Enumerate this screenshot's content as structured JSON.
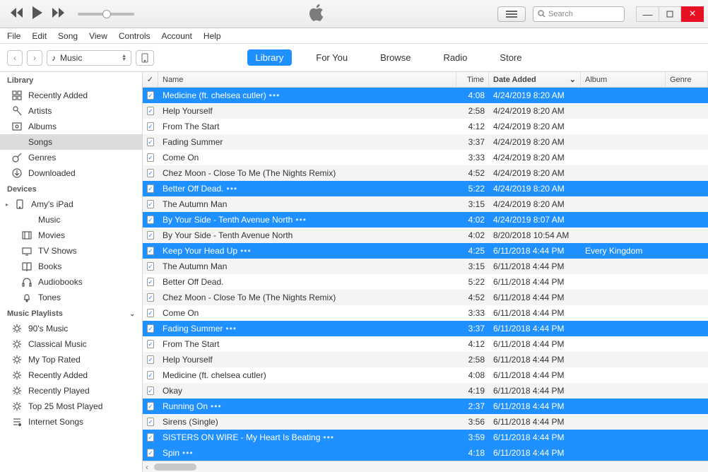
{
  "menu": [
    "File",
    "Edit",
    "Song",
    "View",
    "Controls",
    "Account",
    "Help"
  ],
  "search_placeholder": "Search",
  "media_selector": "Music",
  "nav_tabs": [
    {
      "label": "Library",
      "active": true
    },
    {
      "label": "For You",
      "active": false
    },
    {
      "label": "Browse",
      "active": false
    },
    {
      "label": "Radio",
      "active": false
    },
    {
      "label": "Store",
      "active": false
    }
  ],
  "sidebar": {
    "sections": [
      {
        "title": "Library",
        "items": [
          {
            "label": "Recently Added",
            "icon": "grid"
          },
          {
            "label": "Artists",
            "icon": "mic"
          },
          {
            "label": "Albums",
            "icon": "album"
          },
          {
            "label": "Songs",
            "icon": "note",
            "active": true
          },
          {
            "label": "Genres",
            "icon": "guitar"
          },
          {
            "label": "Downloaded",
            "icon": "download"
          }
        ]
      },
      {
        "title": "Devices",
        "items": [
          {
            "label": "Amy's iPad",
            "icon": "ipad",
            "expand": true
          },
          {
            "label": "Music",
            "icon": "note",
            "sub": true
          },
          {
            "label": "Movies",
            "icon": "film",
            "sub": true
          },
          {
            "label": "TV Shows",
            "icon": "tv",
            "sub": true
          },
          {
            "label": "Books",
            "icon": "book",
            "sub": true
          },
          {
            "label": "Audiobooks",
            "icon": "headphones",
            "sub": true
          },
          {
            "label": "Tones",
            "icon": "bell",
            "sub": true
          }
        ]
      },
      {
        "title": "Music Playlists",
        "chevron": true,
        "items": [
          {
            "label": "90's Music",
            "icon": "gear"
          },
          {
            "label": "Classical Music",
            "icon": "gear"
          },
          {
            "label": "My Top Rated",
            "icon": "gear"
          },
          {
            "label": "Recently Added",
            "icon": "gear"
          },
          {
            "label": "Recently Played",
            "icon": "gear"
          },
          {
            "label": "Top 25 Most Played",
            "icon": "gear"
          },
          {
            "label": "Internet Songs",
            "icon": "playlist"
          }
        ]
      }
    ]
  },
  "columns": {
    "name": "Name",
    "time": "Time",
    "date": "Date Added",
    "album": "Album",
    "genre": "Genre"
  },
  "songs": [
    {
      "name": "Medicine (ft. chelsea cutler)",
      "dots": true,
      "time": "4:08",
      "date": "4/24/2019 8:20 AM",
      "sel": true
    },
    {
      "name": "Help Yourself",
      "time": "2:58",
      "date": "4/24/2019 8:20 AM"
    },
    {
      "name": "From The Start",
      "time": "4:12",
      "date": "4/24/2019 8:20 AM"
    },
    {
      "name": "Fading Summer",
      "time": "3:37",
      "date": "4/24/2019 8:20 AM"
    },
    {
      "name": "Come On",
      "time": "3:33",
      "date": "4/24/2019 8:20 AM"
    },
    {
      "name": "Chez Moon - Close To Me (The Nights Remix)",
      "time": "4:52",
      "date": "4/24/2019 8:20 AM"
    },
    {
      "name": "Better Off Dead.",
      "dots": true,
      "time": "5:22",
      "date": "4/24/2019 8:20 AM",
      "sel": true
    },
    {
      "name": "The Autumn Man",
      "time": "3:15",
      "date": "4/24/2019 8:20 AM"
    },
    {
      "name": "By Your Side - Tenth Avenue North",
      "dots": true,
      "time": "4:02",
      "date": "4/24/2019 8:07 AM",
      "sel": true
    },
    {
      "name": "By Your Side - Tenth Avenue North",
      "time": "4:02",
      "date": "8/20/2018 10:54 AM"
    },
    {
      "name": "Keep Your Head Up",
      "dots": true,
      "time": "4:25",
      "date": "6/11/2018 4:44 PM",
      "album": "Every Kingdom",
      "sel": true
    },
    {
      "name": "The Autumn Man",
      "time": "3:15",
      "date": "6/11/2018 4:44 PM"
    },
    {
      "name": "Better Off Dead.",
      "time": "5:22",
      "date": "6/11/2018 4:44 PM"
    },
    {
      "name": "Chez Moon - Close To Me (The Nights Remix)",
      "time": "4:52",
      "date": "6/11/2018 4:44 PM"
    },
    {
      "name": "Come On",
      "time": "3:33",
      "date": "6/11/2018 4:44 PM"
    },
    {
      "name": "Fading Summer",
      "dots": true,
      "time": "3:37",
      "date": "6/11/2018 4:44 PM",
      "sel": true
    },
    {
      "name": "From The Start",
      "time": "4:12",
      "date": "6/11/2018 4:44 PM"
    },
    {
      "name": "Help Yourself",
      "time": "2:58",
      "date": "6/11/2018 4:44 PM"
    },
    {
      "name": "Medicine (ft. chelsea cutler)",
      "time": "4:08",
      "date": "6/11/2018 4:44 PM"
    },
    {
      "name": "Okay",
      "time": "4:19",
      "date": "6/11/2018 4:44 PM"
    },
    {
      "name": "Running On",
      "dots": true,
      "time": "2:37",
      "date": "6/11/2018 4:44 PM",
      "sel": true
    },
    {
      "name": "Sirens (Single)",
      "time": "3:56",
      "date": "6/11/2018 4:44 PM"
    },
    {
      "name": "SISTERS ON WIRE - My Heart Is Beating",
      "dots": true,
      "time": "3:59",
      "date": "6/11/2018 4:44 PM",
      "sel": true
    },
    {
      "name": "Spin",
      "dots": true,
      "time": "4:18",
      "date": "6/11/2018 4:44 PM",
      "sel": true
    }
  ]
}
